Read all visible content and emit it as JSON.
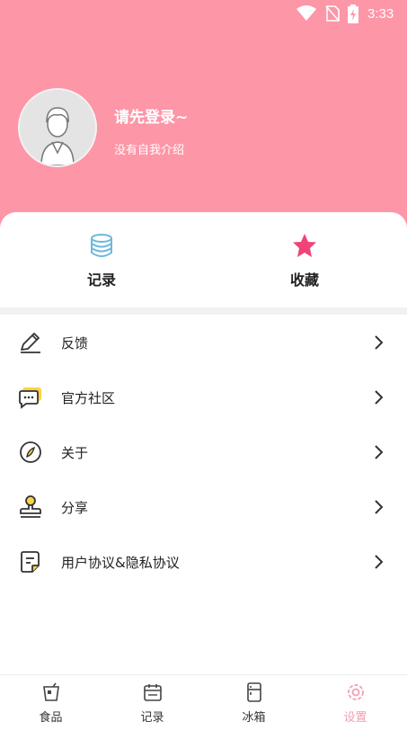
{
  "status_bar": {
    "time": "3:33"
  },
  "profile": {
    "login_prompt": "请先登录~",
    "bio": "没有自我介绍"
  },
  "quick_actions": [
    {
      "label": "记录",
      "icon": "database-icon"
    },
    {
      "label": "收藏",
      "icon": "star-icon"
    }
  ],
  "menu": [
    {
      "label": "反馈",
      "icon": "pencil-icon"
    },
    {
      "label": "官方社区",
      "icon": "chat-bubble-icon"
    },
    {
      "label": "关于",
      "icon": "compass-icon"
    },
    {
      "label": "分享",
      "icon": "stamp-icon"
    },
    {
      "label": "用户协议&隐私协议",
      "icon": "document-icon"
    }
  ],
  "tabbar": [
    {
      "label": "食品",
      "icon": "drink-icon"
    },
    {
      "label": "记录",
      "icon": "calendar-icon"
    },
    {
      "label": "冰箱",
      "icon": "fridge-icon"
    },
    {
      "label": "设置",
      "icon": "flower-gear-icon",
      "active": true
    }
  ],
  "colors": {
    "header": "#fd96a7",
    "star": "#f0437a",
    "active_tab": "#f2a0b0",
    "database_icon": "#6fb8dc"
  }
}
